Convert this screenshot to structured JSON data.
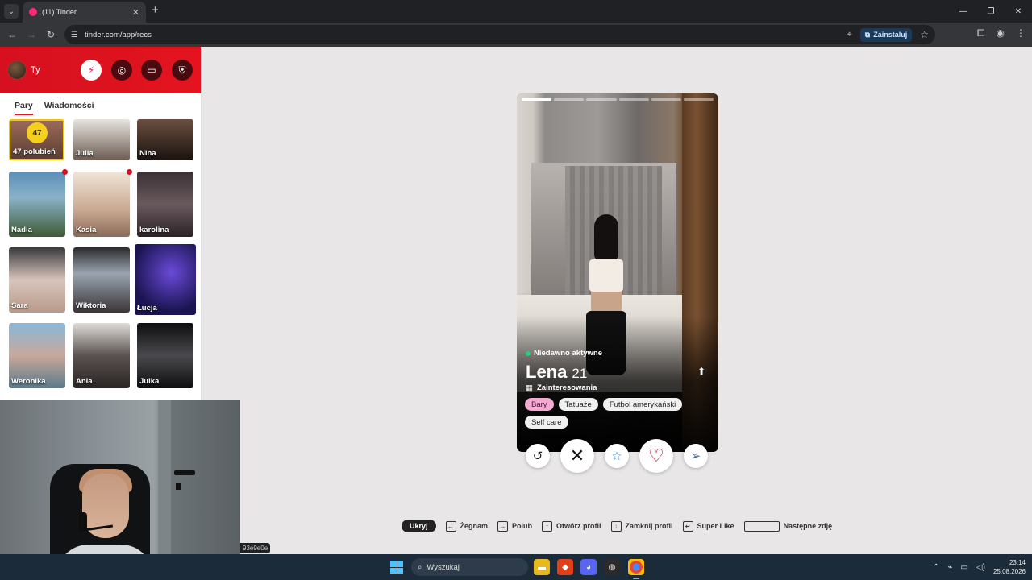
{
  "browser": {
    "tab_title": "(11) Tinder",
    "url": "tinder.com/app/recs",
    "install_label": "Zainstaluj"
  },
  "sidebar": {
    "me_name": "Ty",
    "tabs": [
      {
        "label": "Pary",
        "active": true
      },
      {
        "label": "Wiadomości",
        "active": false
      }
    ],
    "likes": {
      "count": "47",
      "label": "47 polubień"
    },
    "matches": [
      {
        "name": "Julia"
      },
      {
        "name": "Nina"
      },
      {
        "name": "Nadia",
        "new": true
      },
      {
        "name": "Kasia",
        "new": true
      },
      {
        "name": "karolina"
      },
      {
        "name": "Sara"
      },
      {
        "name": "Wiktoria"
      },
      {
        "name": "Łucja",
        "hovered": true
      },
      {
        "name": "Weronika"
      },
      {
        "name": "Ania"
      },
      {
        "name": "Julka"
      }
    ]
  },
  "profile": {
    "status": "Niedawno aktywne",
    "name": "Lena",
    "age": "21",
    "interests_label": "Zainteresowania",
    "chips": [
      {
        "label": "Bary",
        "highlight": true
      },
      {
        "label": "Tatuaże",
        "highlight": false
      },
      {
        "label": "Futbol amerykański",
        "highlight": false
      },
      {
        "label": "Self care",
        "highlight": false
      }
    ],
    "photo_count": 6,
    "active_photo": 1
  },
  "hints": {
    "hide": "Ukryj",
    "nope": "Żegnam",
    "like": "Polub",
    "open": "Otwórz profil",
    "close": "Zamknij profil",
    "superlike": "Super Like",
    "next_photo": "Następne zdję"
  },
  "status_bar_url": "93e9e0e",
  "taskbar": {
    "search_placeholder": "Wyszukaj",
    "time": "23:14",
    "date": "25.08.2026"
  },
  "colors": {
    "brand_red": "#e3141f",
    "like_green": "#21d07a",
    "chip_highlight": "#f4a9d2",
    "likes_gold": "#f4cf1c"
  }
}
